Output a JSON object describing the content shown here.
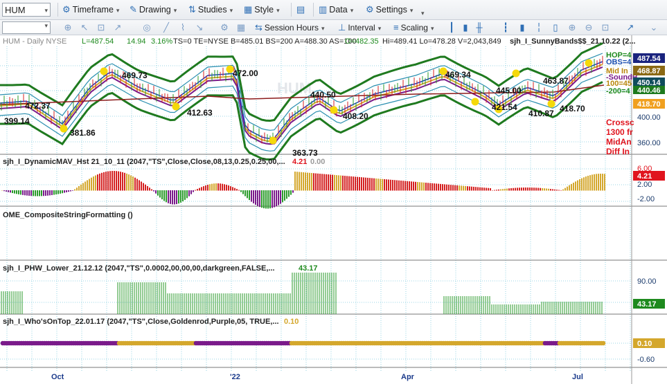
{
  "toolbar": {
    "symbol": "HUM",
    "timeframe": "Timeframe",
    "drawing": "Drawing",
    "studies": "Studies",
    "style": "Style",
    "data": "Data",
    "settings": "Settings",
    "session_hours": "Session Hours",
    "interval": "Interval",
    "scaling": "Scaling"
  },
  "header": {
    "symbol_info": "HUM - Daily  NYSE",
    "last": "L=487.54",
    "change": "14.94",
    "change_pct": "3.16%",
    "rest": "TS=0  TE=NYSE  B=485.01  BS=200  A=488.30  AS=100",
    "open": "O=482.35",
    "hilo": "Hi=489.41  Lo=478.28  V=2,043,849",
    "study": "sjh_I_SunnyBands$$_21.10.22 (2..."
  },
  "price_annotations": {
    "p1": "469.73",
    "p2": "472.00",
    "p3": "472.37",
    "p4": "399.14",
    "p5": "381.86",
    "p6": "412.63",
    "p7": "363.73",
    "p8": "440.50",
    "p9": "408.20",
    "p10": "469.34",
    "p11": "445.00",
    "p12": "421.54",
    "p13": "410.87",
    "p14": "463.87",
    "p15": "418.70"
  },
  "right_axis": {
    "badge_last": "487.54",
    "badge_2": "468.87",
    "badge_3": "450.14",
    "badge_4": "440.46",
    "badge_5": "418.70",
    "ax_400": "400.00",
    "ax_360": "360.00",
    "mavg_badge": "4.21",
    "mavg_6": "6.00",
    "mavg_2": "2.00",
    "mavg_m2": "-2.00",
    "phw_90": "90.00",
    "phw_badge": "43.17",
    "who_badge": "0.10",
    "who_m06": "-0.60"
  },
  "right_notes": {
    "l1": "Crossc",
    "l2": "1300 fr",
    "l3": "MidAn",
    "l4": "Diff  In",
    "hop": "HOP=4",
    "obs": "OBS=4",
    "mid": "Mid In",
    "sound": "-SoundB",
    "l100": "100=45",
    "l200": "-200=4"
  },
  "panels": {
    "p1_title": "sjh_I_DynamicMAV_Hst 21_10_11 (2047,\"TS\",Close,Close,08,13,0.25,0.25,00,...",
    "p1_v1": "4.21",
    "p1_v2": "0.00",
    "p2_title": "OME_CompositeStringFormatting ()",
    "p3_title": "sjh_I_PHW_Lower_21.12.12 (2047,\"TS\",0.0002,00,00,00,darkgreen,FALSE,...",
    "p3_v": "43.17",
    "p4_title": "sjh_I_Who'sOnTop_22.01.17 (2047,\"TS\",Close,Goldenrod,Purple,05, TRUE,...",
    "p4_v": "0.10"
  },
  "time_axis": {
    "t1": "Oct",
    "t2": "'22",
    "t3": "Apr",
    "t4": "Jul"
  },
  "colors": {
    "gold": "#d4a72c",
    "purple": "#7a1a8a",
    "red": "#d42020",
    "green": "#1e8a1e",
    "band": "#1f7a1f",
    "up_bar": "#2a9a2a",
    "down_bar": "#d42020",
    "accent": "#2f6fb5"
  },
  "chart_data": [
    {
      "type": "line",
      "title": "HUM - Daily",
      "x": [
        "Oct",
        "'22",
        "Apr",
        "Jul"
      ],
      "ylim": [
        360,
        490
      ],
      "series": [
        {
          "values": [
            399.14,
            381.86,
            469.73,
            412.63,
            472.0,
            363.73,
            440.5,
            408.2,
            469.34,
            421.54,
            410.87,
            463.87,
            418.7,
            487.54
          ]
        }
      ]
    },
    {
      "type": "bar",
      "title": "sjh_I_DynamicMAV_Hst 21_10_11",
      "ylim": [
        -2,
        6
      ],
      "values": [
        4.21,
        0.0
      ]
    },
    {
      "type": "bar",
      "title": "sjh_I_PHW_Lower_21.12.12",
      "ylim": [
        0,
        100
      ],
      "values": [
        43.17
      ]
    },
    {
      "type": "line",
      "title": "sjh_I_Who'sOnTop_22.01.17",
      "values": [
        0.1
      ]
    }
  ]
}
